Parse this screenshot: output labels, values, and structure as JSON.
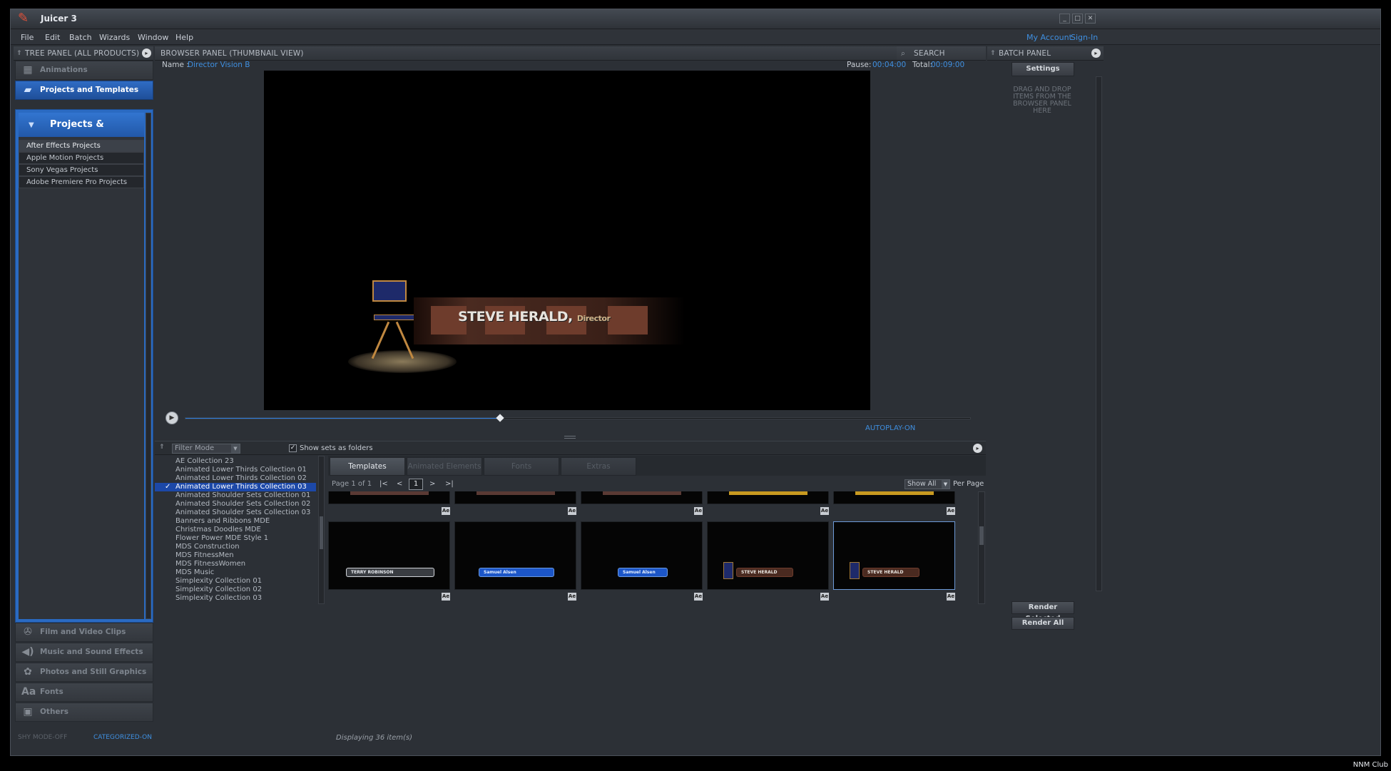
{
  "app": {
    "title": "Juicer 3"
  },
  "menu": [
    "File",
    "Edit",
    "Batch",
    "Wizards",
    "Window",
    "Help"
  ],
  "account": {
    "my_account": "My Account",
    "sign_in": "Sign-In"
  },
  "tree_panel": {
    "title": "TREE PANEL (ALL PRODUCTS)",
    "categories_top": [
      {
        "label": "Animations",
        "icon": "film-grid-icon"
      },
      {
        "label": "Projects and Templates",
        "icon": "projects-icon"
      }
    ],
    "group": {
      "label": "Projects & Templates"
    },
    "items": [
      "After Effects Projects",
      "Apple Motion Projects",
      "Sony Vegas Projects",
      "Adobe Premiere Pro Projects"
    ],
    "categories_bottom": [
      {
        "label": "Film and Video Clips",
        "icon": "film-reel-icon"
      },
      {
        "label": "Music and Sound Effects",
        "icon": "speaker-icon"
      },
      {
        "label": "Photos and Still Graphics",
        "icon": "palette-icon"
      },
      {
        "label": "Fonts",
        "icon": "fonts-icon"
      },
      {
        "label": "Others",
        "icon": "others-icon"
      }
    ],
    "footer": {
      "shy_mode": "SHY MODE-OFF",
      "categorized": "CATEGORIZED-ON"
    }
  },
  "browser_panel": {
    "title": "BROWSER PANEL (THUMBNAIL VIEW)",
    "search_label": "SEARCH",
    "name_label": "Name :",
    "name_value": "Director Vision B",
    "pause_label": "Pause:",
    "pause_value": "00:04:00",
    "total_label": "Total:",
    "total_value": "00:09:00",
    "preview_title": "STEVE HERALD,",
    "preview_subtitle": "Director",
    "playback_progress": 0.4,
    "autoplay": "AUTOPLAY-ON",
    "filter_mode": "Filter Mode",
    "show_sets_label": "Show sets as folders",
    "show_sets_checked": true,
    "collections": [
      "AE Collection 23",
      "Animated Lower Thirds Collection 01",
      "Animated Lower Thirds Collection 02",
      "Animated Lower Thirds Collection 03",
      "Animated Shoulder Sets Collection 01",
      "Animated Shoulder Sets Collection 02",
      "Animated Shoulder Sets Collection 03",
      "Banners and Ribbons MDE",
      "Christmas Doodles MDE",
      "Flower Power MDE Style 1",
      "MDS Construction",
      "MDS FitnessMen",
      "MDS FitnessWomen",
      "MDS Music",
      "Simplexity Collection 01",
      "Simplexity Collection 02",
      "Simplexity Collection 03"
    ],
    "selected_collection_index": 3,
    "tabs": [
      "Templates",
      "Animated Elements",
      "Fonts",
      "Extras"
    ],
    "active_tab": 0,
    "pager": {
      "page_text": "Page 1 of 1",
      "first": "|<",
      "prev": "<",
      "page": "1",
      "next": ">",
      "last": ">|",
      "show_all": "Show All",
      "per_page": "Per Page"
    },
    "thumbnails_row2": [
      {
        "label": "TERRY ROBINSON"
      },
      {
        "label": "Samuel Alsen"
      },
      {
        "label": "Samuel Alsen"
      },
      {
        "label": "STEVE HERALD"
      },
      {
        "label": "STEVE HERALD"
      }
    ],
    "badge": "Ae",
    "status": "Displaying 36 item(s)"
  },
  "batch_panel": {
    "title": "BATCH PANEL",
    "settings": "Settings",
    "drop_hint": "DRAG AND DROP ITEMS FROM THE BROWSER PANEL HERE",
    "render_selected": "Render Selected",
    "render_all": "Render All"
  },
  "watermark": "NNM Club",
  "colors": {
    "accent": "#2f6cc4",
    "link": "#3f8fe0",
    "bg": "#2c3036"
  }
}
